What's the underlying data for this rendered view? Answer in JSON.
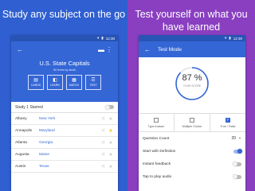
{
  "left": {
    "headline": "Study any subject on the go",
    "status": {
      "time": "12:30"
    },
    "set": {
      "title": "U.S. State Capitals",
      "meta": "50 terms by akoth"
    },
    "modes": [
      {
        "label": "CARDS",
        "icon": "cards-icon",
        "glyph": "▤"
      },
      {
        "label": "LEARN",
        "icon": "learn-icon",
        "glyph": "◧"
      },
      {
        "label": "MATCH",
        "icon": "match-icon",
        "glyph": "▦"
      },
      {
        "label": "TEST",
        "icon": "test-icon",
        "glyph": "☰"
      }
    ],
    "study_starred": {
      "label": "Study 1 Starred",
      "on": false
    },
    "terms": [
      {
        "term": "Albany",
        "definition": "New York",
        "starred": false
      },
      {
        "term": "Annapolis",
        "definition": "Maryland",
        "starred": true
      },
      {
        "term": "Atlanta",
        "definition": "Georgia",
        "starred": false
      },
      {
        "term": "Augusta",
        "definition": "Maine",
        "starred": false
      },
      {
        "term": "Austin",
        "definition": "Texas",
        "starred": false
      }
    ],
    "colors": {
      "bg": "#2f5fd0",
      "appbar": "#3466d6"
    }
  },
  "right": {
    "headline": "Test yourself on what you have learned",
    "status": {
      "time": "12:30"
    },
    "title": "Test Mode",
    "score": {
      "value": 87,
      "label": "87 %",
      "caption": "YOUR SCORE"
    },
    "types": [
      {
        "label": "Type Answer",
        "checked": false
      },
      {
        "label": "Multiple Choice",
        "checked": false
      },
      {
        "label": "True / False",
        "checked": true
      }
    ],
    "question_count": {
      "label": "Question Count",
      "value": "20"
    },
    "options": [
      {
        "label": "Start with Definition",
        "on": true
      },
      {
        "label": "Instant feedback",
        "on": false
      },
      {
        "label": "Tap to play audio",
        "on": false
      }
    ],
    "colors": {
      "bg": "#8a3fc1",
      "accent": "#3466d6"
    }
  }
}
